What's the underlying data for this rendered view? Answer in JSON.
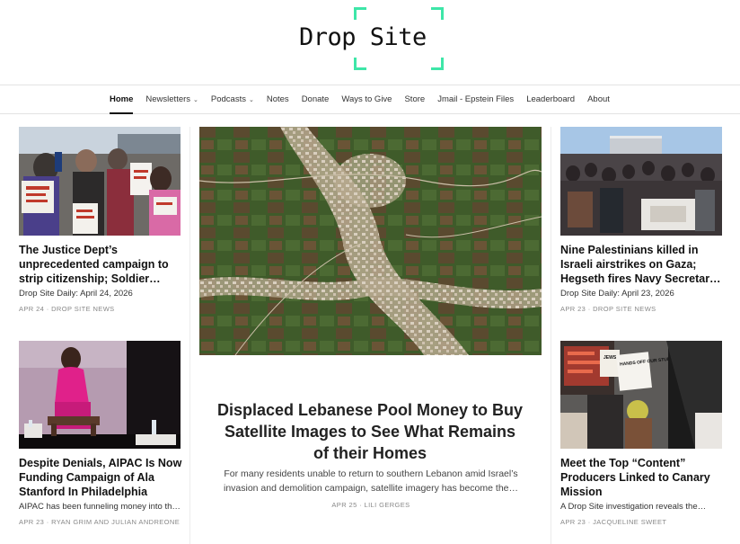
{
  "brand": {
    "name": "Drop Site",
    "accent": "#3ee6a8"
  },
  "nav": {
    "items": [
      {
        "label": "Home",
        "active": true,
        "dropdown": false
      },
      {
        "label": "Newsletters",
        "active": false,
        "dropdown": true
      },
      {
        "label": "Podcasts",
        "active": false,
        "dropdown": true
      },
      {
        "label": "Notes",
        "active": false,
        "dropdown": false
      },
      {
        "label": "Donate",
        "active": false,
        "dropdown": false
      },
      {
        "label": "Ways to Give",
        "active": false,
        "dropdown": false
      },
      {
        "label": "Store",
        "active": false,
        "dropdown": false
      },
      {
        "label": "Jmail - Epstein Files",
        "active": false,
        "dropdown": false
      },
      {
        "label": "Leaderboard",
        "active": false,
        "dropdown": false
      },
      {
        "label": "About",
        "active": false,
        "dropdown": false
      }
    ]
  },
  "articles": {
    "left_top": {
      "title": "The Justice Dept’s unprecedented campaign to strip citizenship; Soldier…",
      "subtitle": "Drop Site Daily: April 24, 2026",
      "meta": "APR 24 · DROP SITE NEWS"
    },
    "left_bottom": {
      "title": "Despite Denials, AIPAC Is Now Funding Campaign of Ala Stanford In Philadelphia",
      "subtitle": "AIPAC has been funneling money into th…",
      "meta": "APR 23 · RYAN GRIM AND JULIAN ANDREONE"
    },
    "center": {
      "title": "Displaced Lebanese Pool Money to Buy Satellite Images to See What Remains of their Homes",
      "subtitle": "For many residents unable to return to southern Lebanon amid Israel’s invasion and demolition campaign, satellite imagery has become the…",
      "meta": "APR 25 · LILI GERGES"
    },
    "right_top": {
      "title": "Nine Palestinians killed in Israeli airstrikes on Gaza; Hegseth fires Navy Secretar…",
      "subtitle": "Drop Site Daily: April 23, 2026",
      "meta": "APR 23 · DROP SITE NEWS"
    },
    "right_bottom": {
      "title": "Meet the Top “Content” Producers Linked to Canary Mission",
      "subtitle": "A Drop Site investigation reveals the…",
      "meta": "APR 23 · JACQUELINE SWEET"
    }
  },
  "image_text": {
    "protest_sign_left": "JEWS SAY STOP",
    "protest_sign_right": "HANDS OFF OUR STUDENTS NOW!"
  }
}
